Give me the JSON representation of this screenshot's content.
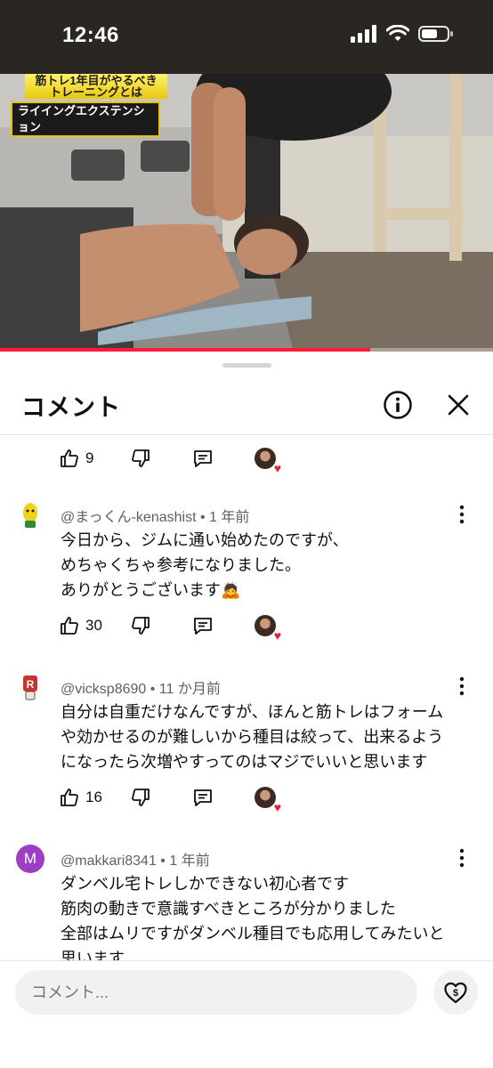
{
  "status": {
    "time": "12:46"
  },
  "video": {
    "caption_top": "筋トレ1年目がやるべきトレーニングとは",
    "caption_main": "ライイングエクステンション",
    "progress": 0.75
  },
  "sheet": {
    "title": "コメント"
  },
  "prev_actions": {
    "likes": "9"
  },
  "comments": [
    {
      "handle": "@まっくん-kenashist",
      "time": "1 年前",
      "lines": [
        "今日から、ジムに通い始めたのですが、",
        "めちゃくちゃ参考になりました。",
        "ありがとうございます🙇"
      ],
      "likes": "30"
    },
    {
      "handle": "@vicksp8690",
      "time": "11 か月前",
      "lines": [
        "自分は自重だけなんですが、ほんと筋トレはフォーム",
        "や効かせるのが難しいから種目は絞って、出来るよう",
        "になったら次増やすってのはマジでいいと思います"
      ],
      "likes": "16"
    },
    {
      "handle": "@makkari8341",
      "avatar_letter": "M",
      "avatar_color": "#9c3fc4",
      "time": "1 年前",
      "lines": [
        "ダンベル宅トレしかできない初心者です",
        "筋肉の動きで意識すべきところが分かりました",
        "全部はムリですがダンベル種目でも応用してみたいと",
        "思います"
      ]
    }
  ],
  "input": {
    "placeholder": "コメント..."
  },
  "colors": {
    "accent_red": "#ff1a3a",
    "text": "#0f0f0f",
    "meta": "#606060"
  }
}
